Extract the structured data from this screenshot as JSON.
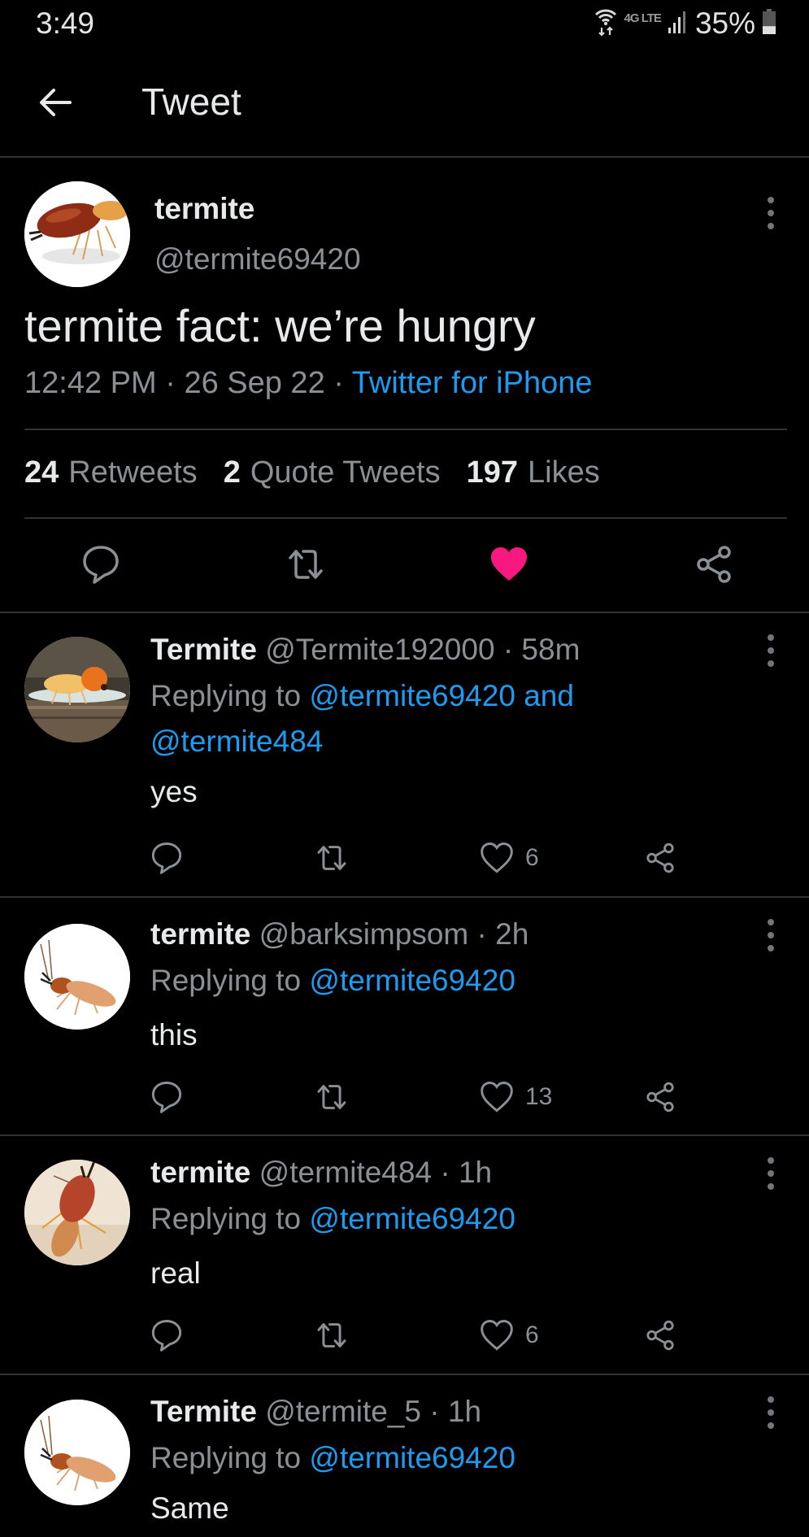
{
  "status_bar": {
    "time": "3:49",
    "network": "4G LTE",
    "battery_percent": "35%",
    "battery_level": 0.35,
    "icons": [
      "wifi-icon",
      "network-4g-icon",
      "signal-icon",
      "battery-icon"
    ]
  },
  "header": {
    "back_icon": "arrow-left-icon",
    "title": "Tweet"
  },
  "main_tweet": {
    "author_name": "termite",
    "author_handle": "@termite69420",
    "text": "termite fact: we’re hungry",
    "time": "12:42 PM",
    "date": "26 Sep 22",
    "separator": " · ",
    "source": "Twitter for iPhone",
    "stats": {
      "retweets_count": "24",
      "retweets_label": "Retweets",
      "quotes_count": "2",
      "quotes_label": "Quote Tweets",
      "likes_count": "197",
      "likes_label": "Likes"
    },
    "liked": true,
    "actions": [
      "reply-icon",
      "retweet-icon",
      "like-icon",
      "share-icon"
    ]
  },
  "colors": {
    "background": "#000000",
    "text_primary": "#e7e9ea",
    "text_secondary": "#8b9095",
    "link": "#1d9bf0",
    "like_active": "#f91880",
    "divider": "#2f3336"
  },
  "replies": [
    {
      "name": "Termite",
      "handle": "@Termite192000",
      "time": "58m",
      "replying_label": "Replying to",
      "mentions_line1": "@termite69420 and",
      "mentions_line2": "@termite484",
      "text": "yes",
      "likes": "6"
    },
    {
      "name": "termite",
      "handle": "@barksimpsom",
      "time": "2h",
      "replying_label": "Replying to",
      "mentions_line1": "@termite69420",
      "text": "this",
      "likes": "13"
    },
    {
      "name": "termite",
      "handle": "@termite484",
      "time": "1h",
      "replying_label": "Replying to",
      "mentions_line1": "@termite69420",
      "text": "real",
      "likes": "6"
    },
    {
      "name": "Termite",
      "handle": "@termite_5",
      "time": "1h",
      "replying_label": "Replying to",
      "mentions_line1": "@termite69420",
      "text": "Same"
    }
  ],
  "dot": "·"
}
